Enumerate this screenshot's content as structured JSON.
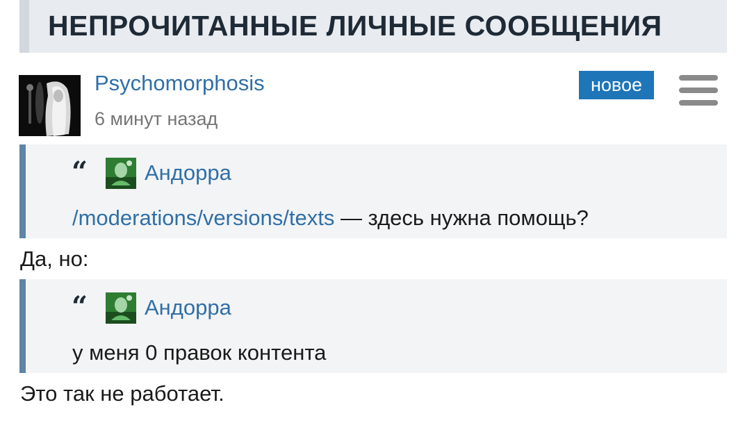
{
  "header": {
    "title": "НЕПРОЧИТАННЫЕ ЛИЧНЫЕ СООБЩЕНИЯ"
  },
  "message": {
    "author": "Psychomorphosis",
    "time": "6 минут назад",
    "badge": "новое",
    "quotes": [
      {
        "name": "Андорра",
        "link": "/moderations/versions/texts",
        "text": " — здесь нужна помощь?"
      },
      {
        "name": "Андорра",
        "text": "у меня 0 правок контента"
      }
    ],
    "replies": [
      "Да, но:",
      "Это так не работает."
    ]
  },
  "icons": {
    "menu": "hamburger-menu-icon",
    "quote": "quote-marks-icon"
  },
  "colors": {
    "accent": "#1e75b8",
    "link": "#2f6fa8",
    "quote_bar": "#5f84a6",
    "quote_bg": "#f3f4f5",
    "header_bg": "#e8ebef"
  }
}
